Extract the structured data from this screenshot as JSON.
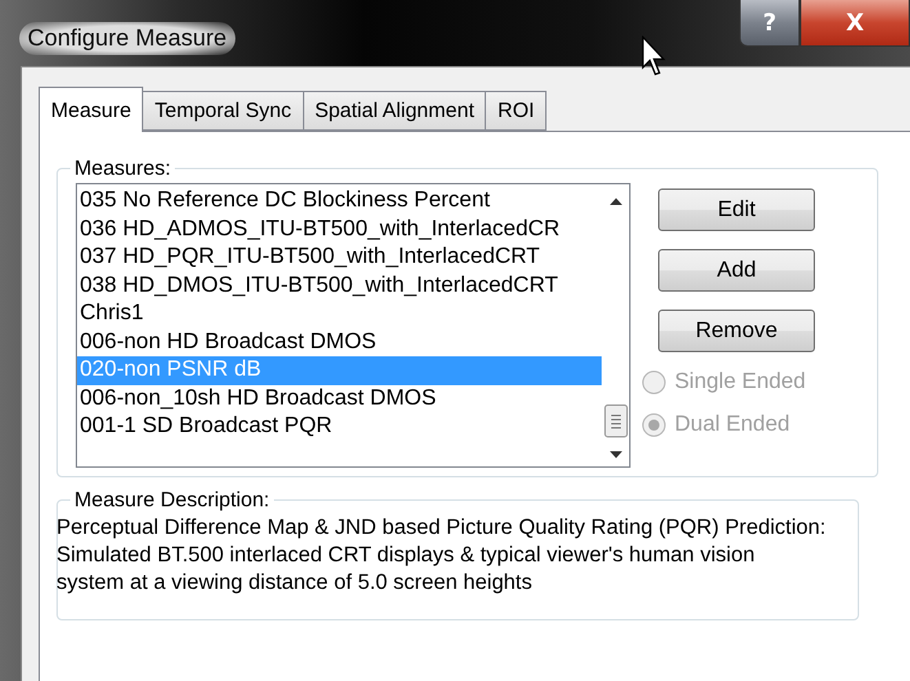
{
  "window": {
    "title": "Configure Measure",
    "buttons": [
      {
        "kind": "help",
        "label": "?"
      },
      {
        "kind": "close",
        "label": "X"
      }
    ]
  },
  "tabs": [
    {
      "label": "Measure",
      "selected": true
    },
    {
      "label": "Temporal Sync",
      "selected": false
    },
    {
      "label": "Spatial Alignment",
      "selected": false
    },
    {
      "label": "ROI",
      "selected": false
    }
  ],
  "measures": {
    "label": "Measures:",
    "items": [
      {
        "label": "035 No Reference DC Blockiness Percent",
        "selected": false
      },
      {
        "label": "036 HD_ADMOS_ITU-BT500_with_InterlacedCR",
        "selected": false
      },
      {
        "label": "037 HD_PQR_ITU-BT500_with_InterlacedCRT",
        "selected": false
      },
      {
        "label": "038 HD_DMOS_ITU-BT500_with_InterlacedCRT",
        "selected": false
      },
      {
        "label": "Chris1",
        "selected": false
      },
      {
        "label": "006-non HD Broadcast DMOS",
        "selected": false
      },
      {
        "label": "020-non PSNR dB",
        "selected": true
      },
      {
        "label": "006-non_10sh HD Broadcast DMOS",
        "selected": false
      },
      {
        "label": "001-1 SD Broadcast PQR",
        "selected": false
      }
    ],
    "buttons": [
      "Edit",
      "Add",
      "Remove"
    ],
    "options": [
      {
        "label": "Single Ended",
        "selected": false,
        "disabled": true
      },
      {
        "label": "Dual Ended",
        "selected": true,
        "disabled": true
      }
    ]
  },
  "description": {
    "label": "Measure Description:",
    "text": "Perceptual Difference Map & JND based Picture Quality Rating  (PQR) Prediction:  Simulated BT.500 interlaced CRT displays & typical viewer's human vision system at a viewing distance of 5.0 screen heights"
  }
}
